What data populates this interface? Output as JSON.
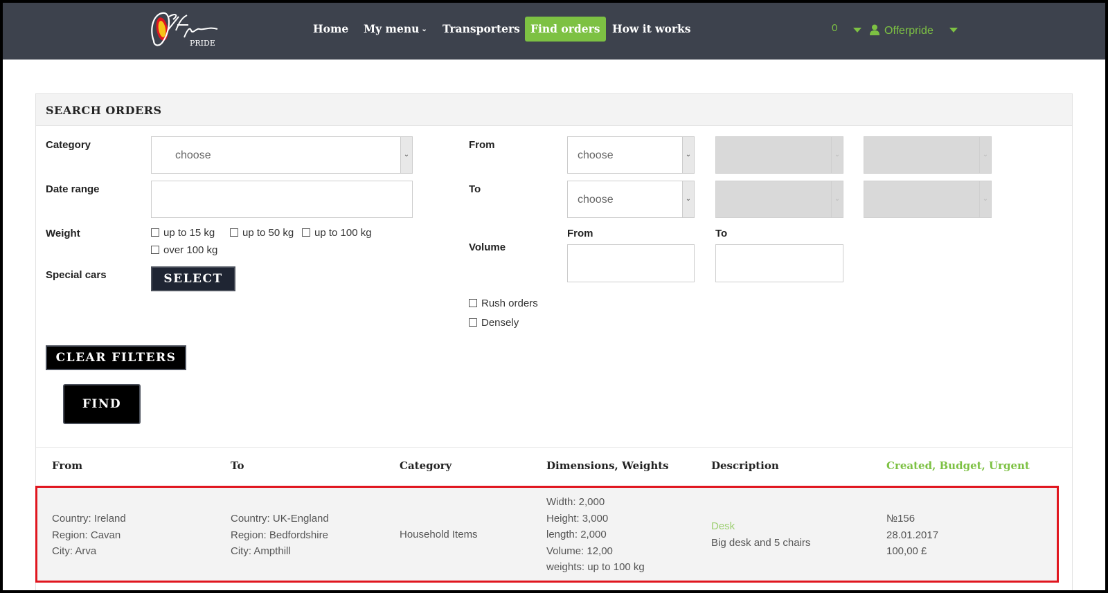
{
  "header": {
    "logo_text": "Offer PRIDE",
    "nav": [
      {
        "label": "Home"
      },
      {
        "label": "My menu"
      },
      {
        "label": "Transporters"
      },
      {
        "label": "Find orders"
      },
      {
        "label": "How it works"
      }
    ],
    "cart_count": "0",
    "user_name": "Offerpride",
    "accent_color": "#7dc143"
  },
  "search": {
    "title": "SEARCH ORDERS",
    "category_label": "Category",
    "category_value": "choose",
    "date_range_label": "Date range",
    "date_range_value": "",
    "weight_label": "Weight",
    "weight_options": [
      "up to 15 kg",
      "up to 50 kg",
      "up to 100 kg",
      "over 100 kg"
    ],
    "special_cars_label": "Special cars",
    "select_button": "SELECT",
    "from_label": "From",
    "from_country": "choose",
    "to_label": "To",
    "to_country": "choose",
    "volume_label": "Volume",
    "volume_from_label": "From",
    "volume_to_label": "To",
    "rush_orders_label": "Rush orders",
    "densely_label": "Densely",
    "clear_filters_button": "CLEAR FILTERS",
    "find_button": "FIND"
  },
  "table": {
    "columns": [
      "From",
      "To",
      "Category",
      "Dimensions, Weights",
      "Description",
      "Created, Budget, Urgent"
    ],
    "rows": [
      {
        "from": [
          "Country: Ireland",
          "Region: Cavan",
          "City: Arva"
        ],
        "to": [
          "Country: UK-England",
          "Region: Bedfordshire",
          "City: Ampthill"
        ],
        "category": "Household Items",
        "dimensions": [
          "Width: 2,000",
          "Height: 3,000",
          "length: 2,000",
          "Volume: 12,00",
          "weights: up to 100 kg"
        ],
        "description_title": "Desk",
        "description_text": "Big desk and 5 chairs",
        "created": [
          "№156",
          "28.01.2017",
          "100,00 £"
        ]
      }
    ]
  }
}
